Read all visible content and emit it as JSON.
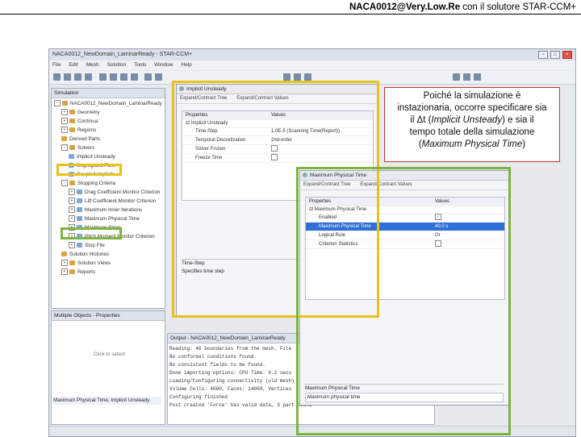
{
  "slide": {
    "title_bold": "NACA0012@Very.Low.Re",
    "title_rest": " con il solutore STAR-CCM+"
  },
  "window": {
    "title": "NACA0012_NewDomain_LaminarReady - STAR-CCM+",
    "menu": [
      "File",
      "Edit",
      "Mesh",
      "Solution",
      "Tools",
      "Window",
      "Help"
    ]
  },
  "simulation_tree": {
    "tab": "Simulation",
    "items": [
      {
        "label": "NACA0012_NewDomain_LaminarReady",
        "indent": 0,
        "toggle": "-",
        "leaf": false
      },
      {
        "label": "Geometry",
        "indent": 1,
        "toggle": "+",
        "leaf": false
      },
      {
        "label": "Continua",
        "indent": 1,
        "toggle": "+",
        "leaf": false
      },
      {
        "label": "Regions",
        "indent": 1,
        "toggle": "+",
        "leaf": false
      },
      {
        "label": "Derived Parts",
        "indent": 1,
        "toggle": "",
        "leaf": false
      },
      {
        "label": "Solvers",
        "indent": 1,
        "toggle": "-",
        "leaf": false
      },
      {
        "label": "Implicit Unsteady",
        "indent": 2,
        "toggle": "",
        "leaf": true
      },
      {
        "label": "Segregated Flow",
        "indent": 2,
        "toggle": "",
        "leaf": true
      },
      {
        "label": "Coupled Implicit",
        "indent": 2,
        "toggle": "",
        "leaf": true
      },
      {
        "label": "Stopping Criteria",
        "indent": 1,
        "toggle": "-",
        "leaf": false
      },
      {
        "label": "Drag Coefficient Monitor Criterion",
        "indent": 2,
        "toggle": "+",
        "leaf": true
      },
      {
        "label": "Lift Coefficient Monitor Criterion",
        "indent": 2,
        "toggle": "+",
        "leaf": true
      },
      {
        "label": "Maximum Inner Iterations",
        "indent": 2,
        "toggle": "+",
        "leaf": true
      },
      {
        "label": "Maximum Physical Time",
        "indent": 2,
        "toggle": "+",
        "leaf": true
      },
      {
        "label": "Maximum Steps",
        "indent": 2,
        "toggle": "+",
        "leaf": true
      },
      {
        "label": "Pitch Moment Monitor Criterion",
        "indent": 2,
        "toggle": "+",
        "leaf": true
      },
      {
        "label": "Stop File",
        "indent": 2,
        "toggle": "+",
        "leaf": true
      },
      {
        "label": "Solution Histories",
        "indent": 1,
        "toggle": "",
        "leaf": false
      },
      {
        "label": "Solution Views",
        "indent": 1,
        "toggle": "+",
        "leaf": false
      },
      {
        "label": "Reports",
        "indent": 1,
        "toggle": "+",
        "leaf": false
      }
    ]
  },
  "properties_panel": {
    "title": "Multiple Objects - Properties",
    "empty_text": "Click to select",
    "footer": "Maximum Physical Time, Implicit Unsteady"
  },
  "implicit_dialog": {
    "title": "Implicit Unsteady",
    "tabs": [
      "Expand/Contract Tree",
      "Expand/Contract Values"
    ],
    "col_properties": "Properties",
    "col_values": "Values",
    "group": "Implicit Unsteady",
    "rows": [
      {
        "name": "Time-Step",
        "value": "1.0E-5 (Scanning Time(Report))",
        "checkbox": false
      },
      {
        "name": "Temporal Discretization",
        "value": "2nd-order",
        "checkbox": false
      },
      {
        "name": "Solver Frozen",
        "value": "",
        "checkbox": true
      },
      {
        "name": "Freeze Time",
        "value": "",
        "checkbox": true
      }
    ],
    "desc_title": "Time-Step",
    "desc_text": "Specifies time step"
  },
  "maxtime_dialog": {
    "title": "Maximum Physical Time",
    "tabs": [
      "Expand/Contract Tree",
      "Expand/Contract Values"
    ],
    "col_properties": "Properties",
    "col_values": "Values",
    "group": "Maximum Physical Time",
    "rows": [
      {
        "name": "Enabled",
        "value": "",
        "checkbox": true,
        "checked": true,
        "selected": false
      },
      {
        "name": "Maximum Physical Time",
        "value": "40.0 s",
        "checkbox": false,
        "selected": true
      },
      {
        "name": "Logical Rule",
        "value": "Or",
        "checkbox": false,
        "selected": false
      },
      {
        "name": "Criterion Statistics",
        "value": "",
        "checkbox": true,
        "checked": false,
        "selected": false
      }
    ],
    "desc_title": "Maximum Physical Time",
    "desc_text": "Maximum physical time"
  },
  "callout": {
    "line1": "Poiché la simulazione è",
    "line2": "instazionaria, occorre specificare sia",
    "line3_pre": "il Δt (",
    "line3_italic": "Implicit Unsteady",
    "line3_post": ") e sia il",
    "line4": "tempo totale della simulazione",
    "line5_pre": "(",
    "line5_italic": "Maximum Physical Time",
    "line5_post": ")"
  },
  "output": {
    "title": "Output - NACA0012_NewDomain_LaminarReady",
    "lines": [
      "Reading: 40 boundaries from the mesh. File",
      "No conformal conditions found.",
      "No consistent fields to be found.",
      "Done importing options: CPU Time: 0.2 secs",
      "Loading/Configuring connectivity (old mesh)",
      "  Volume Cells: 4000, Faces: 14000, Vertices",
      "Configuring finished",
      "Post created 'Force' has valid data, 3 part bound"
    ]
  },
  "colors": {
    "highlight_yellow": "#e8c21a",
    "highlight_green": "#7db33e",
    "callout_border": "#c0392b",
    "selection_blue": "#2f6fd6"
  }
}
